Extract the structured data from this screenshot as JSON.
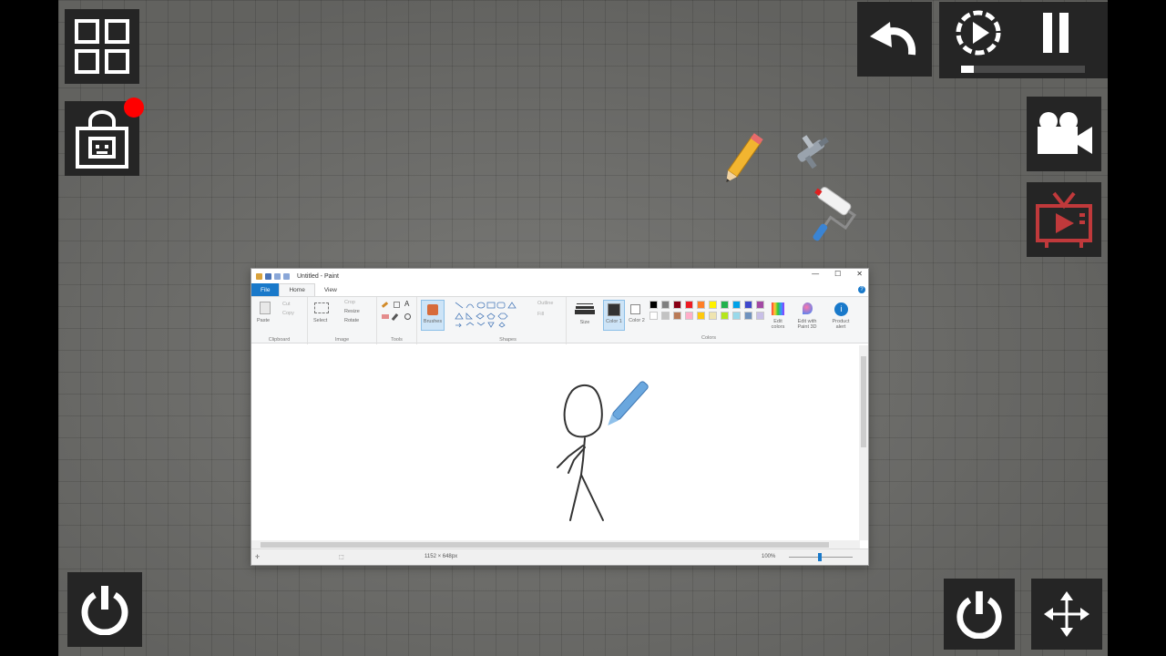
{
  "paint": {
    "title": "Untitled - Paint",
    "tabs": {
      "file": "File",
      "home": "Home",
      "view": "View"
    },
    "ribbon": {
      "paste": "Paste",
      "cut": "Cut",
      "copy": "Copy",
      "select": "Select",
      "crop": "Crop",
      "resize": "Resize",
      "rotate": "Rotate",
      "brushes": "Brushes",
      "outline": "Outline",
      "fill": "Fill",
      "size": "Size",
      "color1": "Color 1",
      "color2": "Color 2",
      "edit_colors": "Edit colors",
      "edit_paint3d": "Edit with Paint 3D",
      "product_alert": "Product alert",
      "groups": {
        "clipboard": "Clipboard",
        "image": "Image",
        "tools": "Tools",
        "shapes": "Shapes",
        "colors": "Colors"
      },
      "palette": [
        "#000000",
        "#7f7f7f",
        "#880015",
        "#ed1c24",
        "#ff7f27",
        "#fff200",
        "#22b14c",
        "#00a2e8",
        "#3f48cc",
        "#a349a4",
        "#ffffff",
        "#c3c3c3",
        "#b97a57",
        "#ffaec9",
        "#ffc90e",
        "#efe4b0",
        "#b5e61d",
        "#99d9ea",
        "#7092be",
        "#c8bfe7"
      ]
    },
    "status": {
      "dimensions": "1152 × 648px",
      "zoom": "100%"
    }
  },
  "colors": {
    "hud_bg": "#252525",
    "notification": "#ff0000",
    "tv_icon": "#c0393b"
  },
  "icons": {
    "grid": "grid-menu-icon",
    "shop": "shop-bag-icon",
    "undo": "undo-icon",
    "slowmo": "slow-motion-icon",
    "pause": "pause-icon",
    "camera": "camera-icon",
    "tv": "tv-icon",
    "power": "power-icon",
    "move": "move-arrows-icon"
  },
  "progress": {
    "slowmo_level": 0.1
  }
}
